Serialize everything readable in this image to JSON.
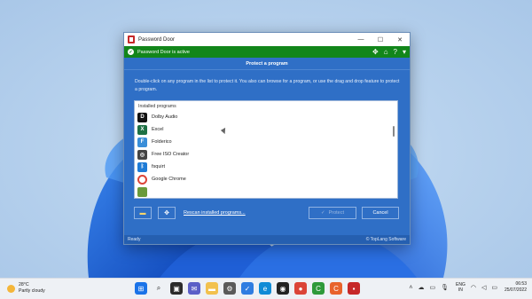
{
  "window": {
    "title": "Password Door",
    "status": "Password Door is active",
    "header": "Protect a program",
    "description": "Double-click on any program in the list to protect it. You also can browse for a program, or use the drag and drop feature to protect a program.",
    "list_header": "Installed programs",
    "programs": [
      {
        "name": "Dolby Audio",
        "color": "#111111",
        "glyph": "D"
      },
      {
        "name": "Excel",
        "color": "#1d7044",
        "glyph": "X"
      },
      {
        "name": "Folderico",
        "color": "#3a8ed8",
        "glyph": "F"
      },
      {
        "name": "Free ISO Creator",
        "color": "#444444",
        "glyph": "◎"
      },
      {
        "name": "fsquirt",
        "color": "#1e7bd6",
        "glyph": "ᛒ"
      },
      {
        "name": "Google Chrome",
        "color": "#db4437",
        "glyph": "●"
      },
      {
        "name": "",
        "color": "#6a9a3a",
        "glyph": ""
      }
    ],
    "rescan_label": "Rescan installed programs...",
    "protect_label": "Protect",
    "cancel_label": "Cancel",
    "footer_status": "Ready",
    "footer_brand": "© TopLang Software"
  },
  "taskbar": {
    "weather_temp": "28°C",
    "weather_desc": "Partly cloudy",
    "lang_top": "ENG",
    "lang_bottom": "IN",
    "time": "06:53",
    "date": "25/07/2022"
  }
}
